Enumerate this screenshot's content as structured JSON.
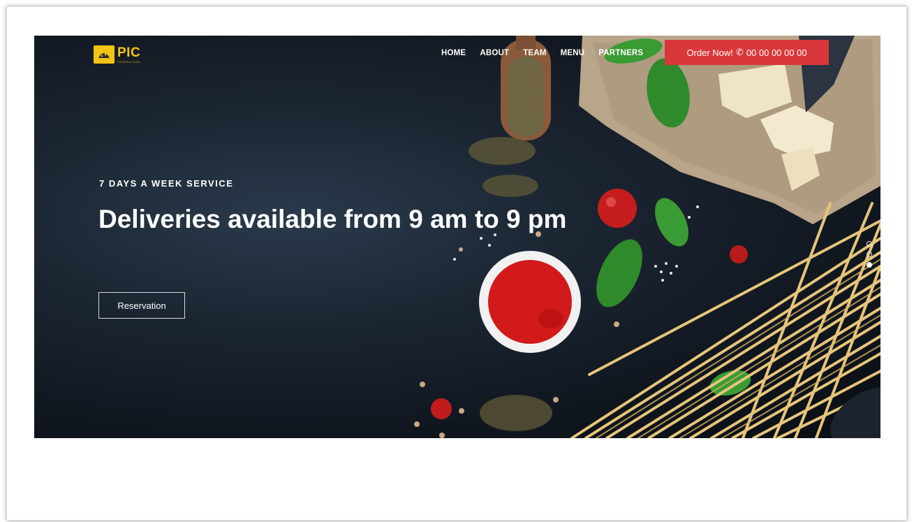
{
  "logo": {
    "text": "PIC",
    "subtext": "PIZZERIA CLUB"
  },
  "nav": {
    "items": [
      "HOME",
      "ABOUT",
      "TEAM",
      "MENU",
      "PARTNERS"
    ]
  },
  "order": {
    "label": "Order Now!",
    "phone": "00 00 00 00 00",
    "phone_icon": "phone-icon"
  },
  "hero": {
    "kicker": "7 DAYS A WEEK SERVICE",
    "headline": "Deliveries available from 9 am to 9 pm",
    "cta_label": "Reservation"
  },
  "slider": {
    "count": 3,
    "active": 3
  },
  "colors": {
    "accent": "#d9383a",
    "brand": "#f2c413",
    "hero_bg": "#141c26"
  }
}
